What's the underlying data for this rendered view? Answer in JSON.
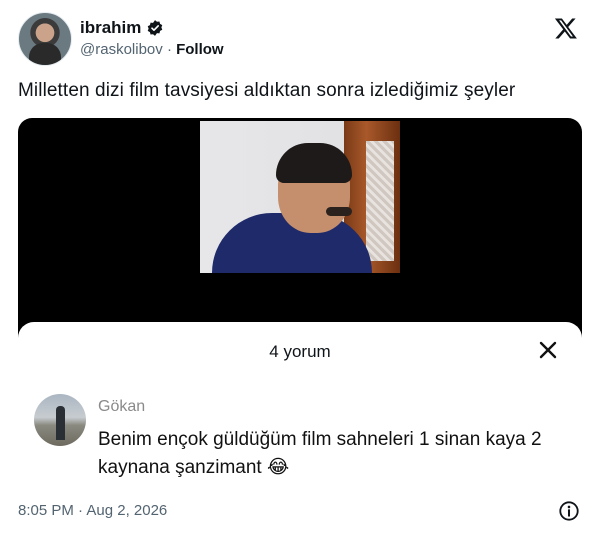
{
  "author": {
    "display_name": "ibrahim",
    "handle": "@raskolibov",
    "separator": "·",
    "follow_label": "Follow"
  },
  "tweet": {
    "text": "Milletten dizi film tavsiyesi aldıktan sonra izlediğimiz şeyler"
  },
  "comments_sheet": {
    "title": "4 yorum",
    "comment": {
      "author": "Gökan",
      "text": "Benim ençok güldüğüm film sahneleri 1 sinan kaya 2 kaynana şanzimant 😂"
    }
  },
  "footer": {
    "timestamp": "8:05 PM · Aug 2, 2026"
  },
  "icons": {
    "verified": "verified-badge-icon",
    "brand": "x-logo-icon",
    "close": "close-icon",
    "info": "info-icon"
  },
  "colors": {
    "text_primary": "#0f1419",
    "text_secondary": "#536471",
    "media_background": "#000000"
  }
}
